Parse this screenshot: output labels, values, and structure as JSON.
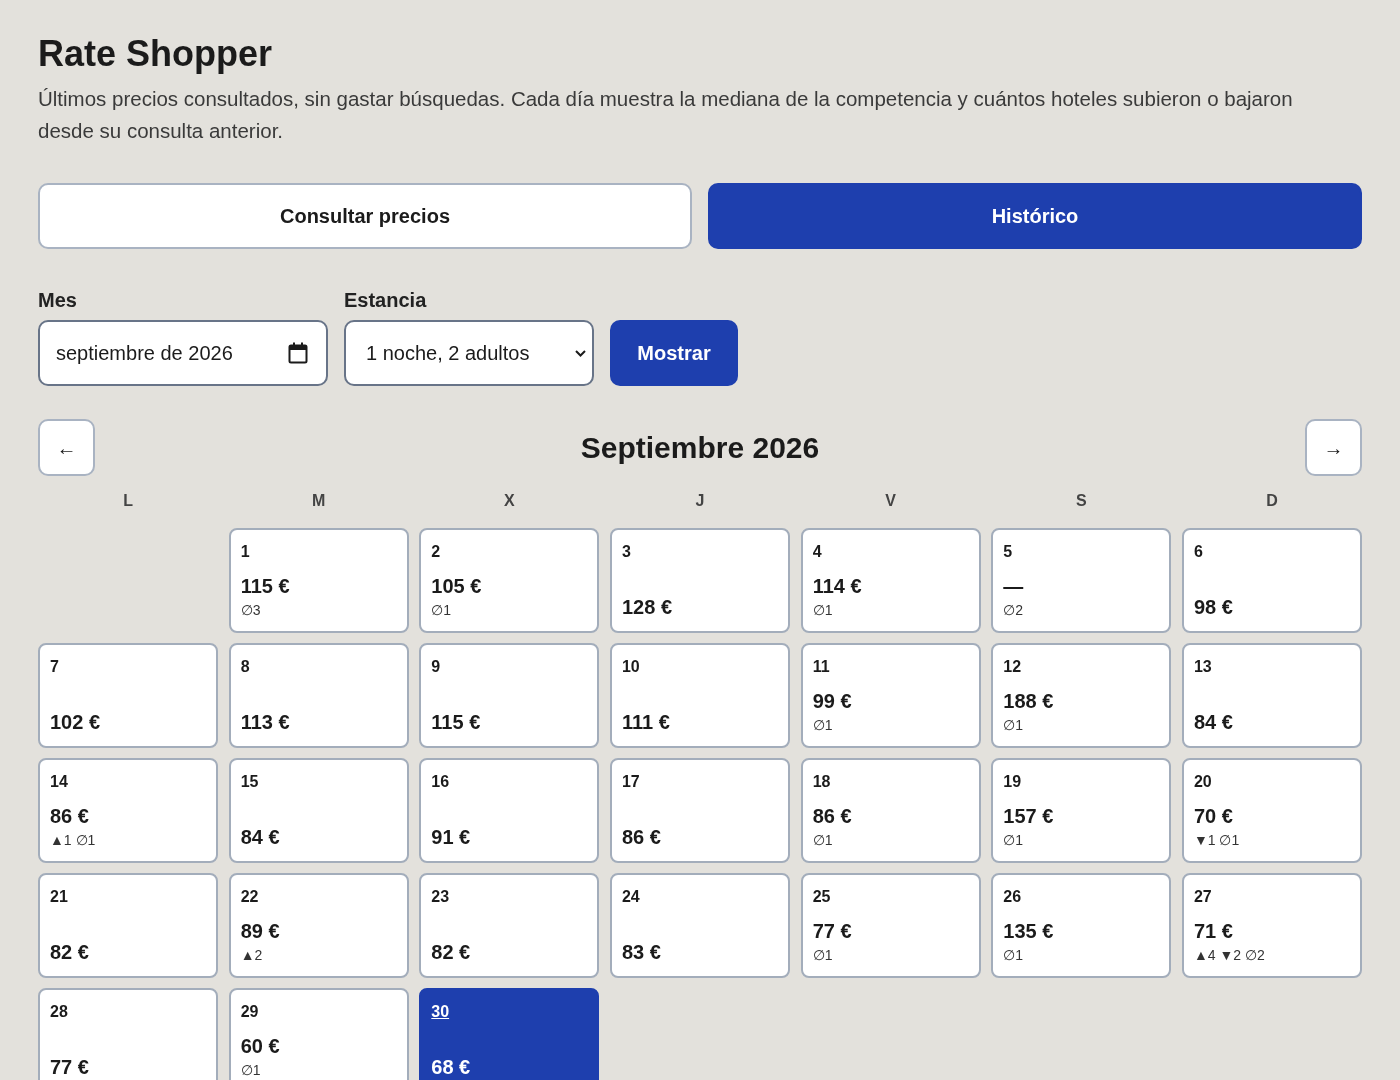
{
  "header": {
    "title": "Rate Shopper",
    "subtitle": "Últimos precios consultados, sin gastar búsquedas. Cada día muestra la mediana de la competencia y cuántos hoteles subieron o bajaron desde su consulta anterior."
  },
  "tabs": [
    {
      "label": "Consultar precios",
      "selected": false
    },
    {
      "label": "Histórico",
      "selected": true
    }
  ],
  "form": {
    "month": {
      "label": "Mes",
      "value": "septiembre de 2026"
    },
    "stay": {
      "label": "Estancia",
      "value": "1 noche, 2 adultos"
    },
    "submit": "Mostrar"
  },
  "calendar": {
    "prev": "←",
    "title": "Septiembre 2026",
    "next": "→",
    "weekdays": [
      "L",
      "M",
      "X",
      "J",
      "V",
      "S",
      "D"
    ],
    "weeks": [
      [
        {
          "kind": "empty"
        },
        {
          "kind": "day",
          "day": "1",
          "price": "115 €",
          "changes": "∅3",
          "selected": false
        },
        {
          "kind": "day",
          "day": "2",
          "price": "105 €",
          "changes": "∅1",
          "selected": false
        },
        {
          "kind": "day",
          "day": "3",
          "price": "128 €",
          "selected": false
        },
        {
          "kind": "day",
          "day": "4",
          "price": "114 €",
          "changes": "∅1",
          "selected": false
        },
        {
          "kind": "day",
          "day": "5",
          "price": "—",
          "changes": "∅2",
          "selected": false
        },
        {
          "kind": "day",
          "day": "6",
          "price": "98 €",
          "selected": false
        }
      ],
      [
        {
          "kind": "day",
          "day": "7",
          "price": "102 €",
          "selected": false
        },
        {
          "kind": "day",
          "day": "8",
          "price": "113 €",
          "selected": false
        },
        {
          "kind": "day",
          "day": "9",
          "price": "115 €",
          "selected": false
        },
        {
          "kind": "day",
          "day": "10",
          "price": "111 €",
          "selected": false
        },
        {
          "kind": "day",
          "day": "11",
          "price": "99 €",
          "changes": "∅1",
          "selected": false
        },
        {
          "kind": "day",
          "day": "12",
          "price": "188 €",
          "changes": "∅1",
          "selected": false
        },
        {
          "kind": "day",
          "day": "13",
          "price": "84 €",
          "selected": false
        }
      ],
      [
        {
          "kind": "day",
          "day": "14",
          "price": "86 €",
          "changes": "▲1 ∅1",
          "selected": false
        },
        {
          "kind": "day",
          "day": "15",
          "price": "84 €",
          "selected": false
        },
        {
          "kind": "day",
          "day": "16",
          "price": "91 €",
          "selected": false
        },
        {
          "kind": "day",
          "day": "17",
          "price": "86 €",
          "selected": false
        },
        {
          "kind": "day",
          "day": "18",
          "price": "86 €",
          "changes": "∅1",
          "selected": false
        },
        {
          "kind": "day",
          "day": "19",
          "price": "157 €",
          "changes": "∅1",
          "selected": false
        },
        {
          "kind": "day",
          "day": "20",
          "price": "70 €",
          "changes": "▼1 ∅1",
          "selected": false
        }
      ],
      [
        {
          "kind": "day",
          "day": "21",
          "price": "82 €",
          "selected": false
        },
        {
          "kind": "day",
          "day": "22",
          "price": "89 €",
          "changes": "▲2",
          "selected": false
        },
        {
          "kind": "day",
          "day": "23",
          "price": "82 €",
          "selected": false
        },
        {
          "kind": "day",
          "day": "24",
          "price": "83 €",
          "selected": false
        },
        {
          "kind": "day",
          "day": "25",
          "price": "77 €",
          "changes": "∅1",
          "selected": false
        },
        {
          "kind": "day",
          "day": "26",
          "price": "135 €",
          "changes": "∅1",
          "selected": false
        },
        {
          "kind": "day",
          "day": "27",
          "price": "71 €",
          "changes": "▲4 ▼2 ∅2",
          "selected": false
        }
      ],
      [
        {
          "kind": "day",
          "day": "28",
          "price": "77 €",
          "selected": false
        },
        {
          "kind": "day",
          "day": "29",
          "price": "60 €",
          "changes": "∅1",
          "selected": false
        },
        {
          "kind": "day",
          "day": "30",
          "price": "68 €",
          "selected": true
        }
      ]
    ]
  }
}
